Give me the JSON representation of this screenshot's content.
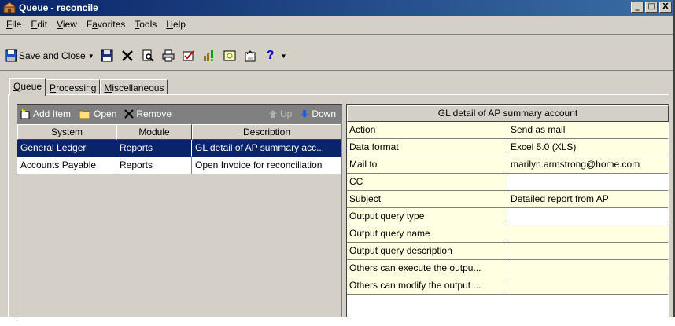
{
  "window": {
    "title": "Queue - reconcile",
    "controls": [
      "_",
      "□",
      "X"
    ]
  },
  "menu": [
    {
      "label": "File",
      "u": "F",
      "rest": "ile"
    },
    {
      "label": "Edit",
      "u": "E",
      "rest": "dit"
    },
    {
      "label": "View",
      "u": "V",
      "rest": "iew"
    },
    {
      "label": "Favorites",
      "pre": "F",
      "u": "a",
      "rest": "vorites"
    },
    {
      "label": "Tools",
      "u": "T",
      "rest": "ools"
    },
    {
      "label": "Help",
      "u": "H",
      "rest": "elp"
    }
  ],
  "toolbar": {
    "save_close_label": "Save and Close",
    "icons": [
      "save-icon",
      "delete-icon",
      "print-preview-icon",
      "print-icon",
      "check-icon",
      "run-icon",
      "image-icon",
      "properties-icon",
      "help-icon"
    ]
  },
  "tabs": [
    {
      "label": "Queue",
      "u": "Q",
      "rest": "ueue",
      "active": true
    },
    {
      "label": "Processing",
      "u": "P",
      "rest": "rocessing",
      "active": false
    },
    {
      "label": "Miscellaneous",
      "u": "M",
      "rest": "iscellaneous",
      "active": false
    }
  ],
  "left_toolbar": {
    "add_item": "Add Item",
    "open": "Open",
    "remove": "Remove",
    "up": "Up",
    "down": "Down"
  },
  "grid": {
    "columns": [
      "System",
      "Module",
      "Description"
    ],
    "rows": [
      {
        "system": "General Ledger",
        "module": "Reports",
        "description": "GL detail of AP summary acc...",
        "selected": true
      },
      {
        "system": "Accounts Payable",
        "module": "Reports",
        "description": "Open Invoice for reconciliation",
        "selected": false
      }
    ]
  },
  "properties": {
    "header": "GL detail of AP summary account",
    "rows": [
      {
        "key": "Action",
        "value": "Send as mail"
      },
      {
        "key": "Data format",
        "value": "Excel 5.0 (XLS)"
      },
      {
        "key": "Mail to",
        "value": "marilyn.armstrong@home.com"
      },
      {
        "key": "CC",
        "value": ""
      },
      {
        "key": "Subject",
        "value": "Detailed report from AP"
      },
      {
        "key": "Output query type",
        "value": ""
      },
      {
        "key": "Output query name",
        "value": ""
      },
      {
        "key": "Output query description",
        "value": ""
      },
      {
        "key": "Others can execute the outpu...",
        "value": ""
      },
      {
        "key": "Others can modify the output ...",
        "value": ""
      }
    ]
  },
  "colors": {
    "title_start": "#0a246a",
    "title_end": "#3a6ea5",
    "selection": "#0a246a",
    "property_bg": "#ffffe1",
    "face": "#d4d0c8"
  }
}
